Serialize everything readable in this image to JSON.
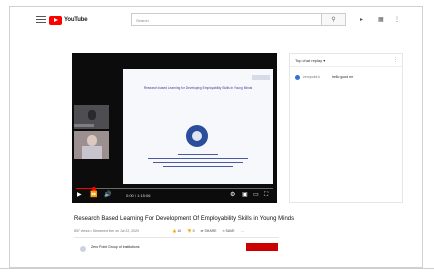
{
  "header": {
    "logo_text": "YouTube",
    "search_placeholder": "Search",
    "search_icon": "search-icon",
    "right_icons": [
      "video-camera-icon",
      "apps-grid-icon",
      "more-vert-icon"
    ]
  },
  "player": {
    "slide_title": "Research based Learning for Developing Employability Skills in Young Minds",
    "time_display": "0:00 / 1:15:06",
    "progress_fraction": 0.09,
    "controls_left": [
      "play-icon",
      "next-icon",
      "volume-icon"
    ],
    "controls_right": [
      "settings-icon",
      "miniplayer-icon",
      "theater-icon",
      "fullscreen-icon"
    ]
  },
  "video": {
    "title": "Research Based Learning For Development Of Employability Skills in Young Minds",
    "meta": "857 views • Streamed live on Jul 22, 2020",
    "actions": {
      "like": "10",
      "dislike": "0",
      "share": "SHARE",
      "save": "SAVE",
      "more": "…"
    },
    "channel_name": "Zero Point Group of Institutions"
  },
  "chat": {
    "title": "Top chat replay ▾",
    "more": "⋮",
    "messages": [
      {
        "author": "zeropoint k",
        "text": "hello good mr"
      }
    ]
  },
  "colors": {
    "brand_red": "#ff0000",
    "subscribe_red": "#cc0000",
    "slide_blue": "#3a3f8f"
  }
}
